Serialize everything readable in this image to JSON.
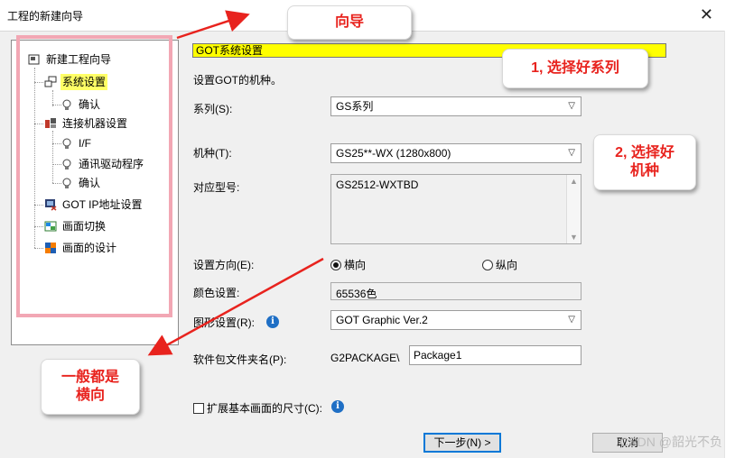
{
  "window": {
    "title": "工程的新建向导",
    "close": "✕"
  },
  "tree": {
    "root": "新建工程向导",
    "items": [
      "系统设置",
      "确认",
      "连接机器设置",
      "I/F",
      "通讯驱动程序",
      "确认",
      "GOT IP地址设置",
      "画面切换",
      "画面的设计"
    ],
    "selected": "系统设置"
  },
  "form": {
    "header": "GOT系统设置",
    "description": "设置GOT的机种。",
    "series_label": "系列(S):",
    "series_value": "GS系列",
    "model_label": "机种(T):",
    "model_value": "GS25**-WX (1280x800)",
    "compatible_label": "对应型号:",
    "compatible_value": "GS2512-WXTBD",
    "orientation_label": "设置方向(E):",
    "orientation_horizontal": "横向",
    "orientation_vertical": "纵向",
    "orientation_selected": "横向",
    "color_label": "颜色设置:",
    "color_value": "65536色",
    "graphic_label": "图形设置(R):",
    "graphic_value": "GOT Graphic Ver.2",
    "package_label": "软件包文件夹名(P):",
    "package_prefix": "G2PACKAGE\\",
    "package_value": "Package1",
    "expand_label": "扩展基本画面的尺寸(C):",
    "next_button": "下一步(N) >",
    "cancel_button": "取消"
  },
  "annotations": {
    "guide": "向导",
    "step1": "1, 选择好系列",
    "step2_line1": "2, 选择好",
    "step2_line2": "机种",
    "note_line1": "一般都是",
    "note_line2": "横向"
  },
  "watermark": "CSDN @韶光不负",
  "colors": {
    "callout_text": "#e8231e",
    "arrow": "#e8231e",
    "highlight": "#ffff00",
    "frame": "#f2a7b4"
  }
}
